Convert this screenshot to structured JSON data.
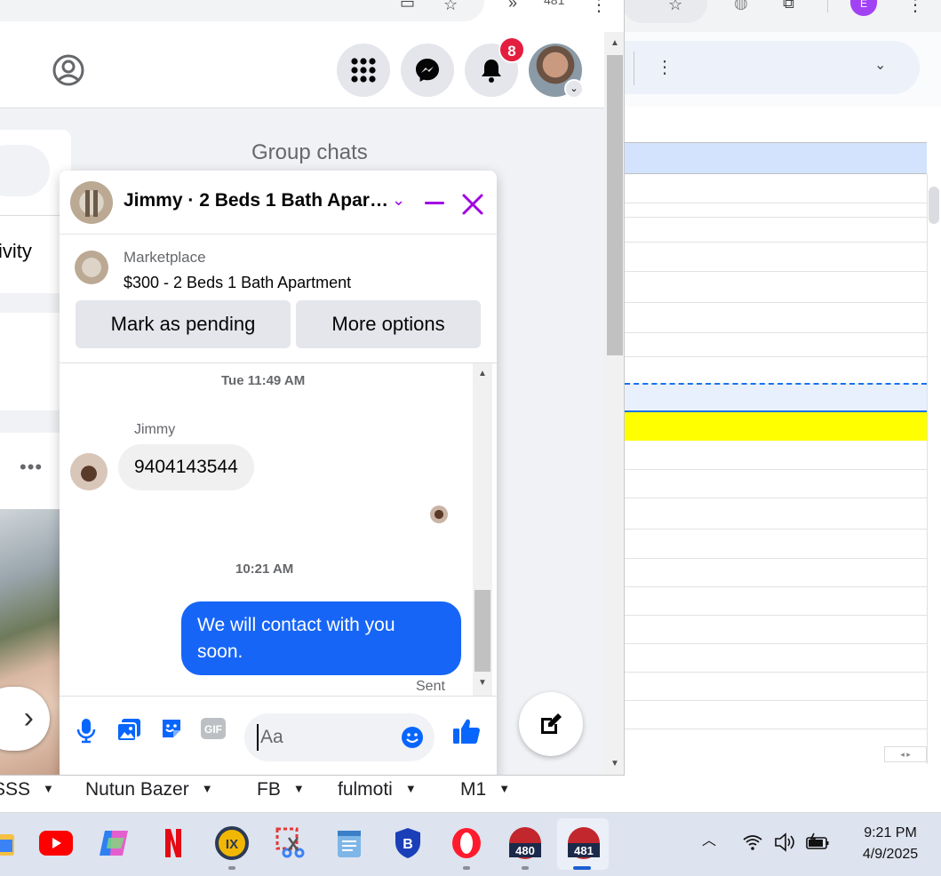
{
  "facebook": {
    "header": {
      "notification_count": "8"
    },
    "sidebar_fragment": "ivity",
    "group_chats_label": "Group chats"
  },
  "chat": {
    "title": "Jimmy · 2 Beds 1 Bath Apartment",
    "marketplace_label": "Marketplace",
    "listing": "$300 - 2 Beds 1 Bath Apartment",
    "buttons": {
      "mark_pending": "Mark as pending",
      "more_options": "More options"
    },
    "messages": [
      {
        "timestamp": "Tue 11:49 AM",
        "sender": "Jimmy",
        "text": "9404143544",
        "direction": "incoming"
      },
      {
        "timestamp": "10:21 AM",
        "text": "We will contact with you soon.",
        "direction": "outgoing",
        "status": "Sent"
      }
    ],
    "composer": {
      "placeholder": "Aa"
    }
  },
  "bookmarks": [
    {
      "label": "SSS"
    },
    {
      "label": "Nutun Bazer"
    },
    {
      "label": "FB"
    },
    {
      "label": "fulmoti"
    },
    {
      "label": "M1"
    }
  ],
  "taskbar": {
    "apps": [
      "file-explorer",
      "youtube",
      "copilot",
      "netflix",
      "ixl",
      "snipping-tool",
      "notepad",
      "bitwarden",
      "opera",
      "480",
      "481"
    ],
    "badge_480": "480",
    "badge_481": "481",
    "time": "9:21 PM",
    "date": "4/9/2025"
  },
  "background_window": {
    "profile_letter": "E",
    "tab_count": "481"
  },
  "colors": {
    "messenger_accent": "#a100e2",
    "outgoing_bubble": "#1665f7",
    "notification_red": "#e41e3f",
    "highlight_yellow": "#ffff00"
  }
}
